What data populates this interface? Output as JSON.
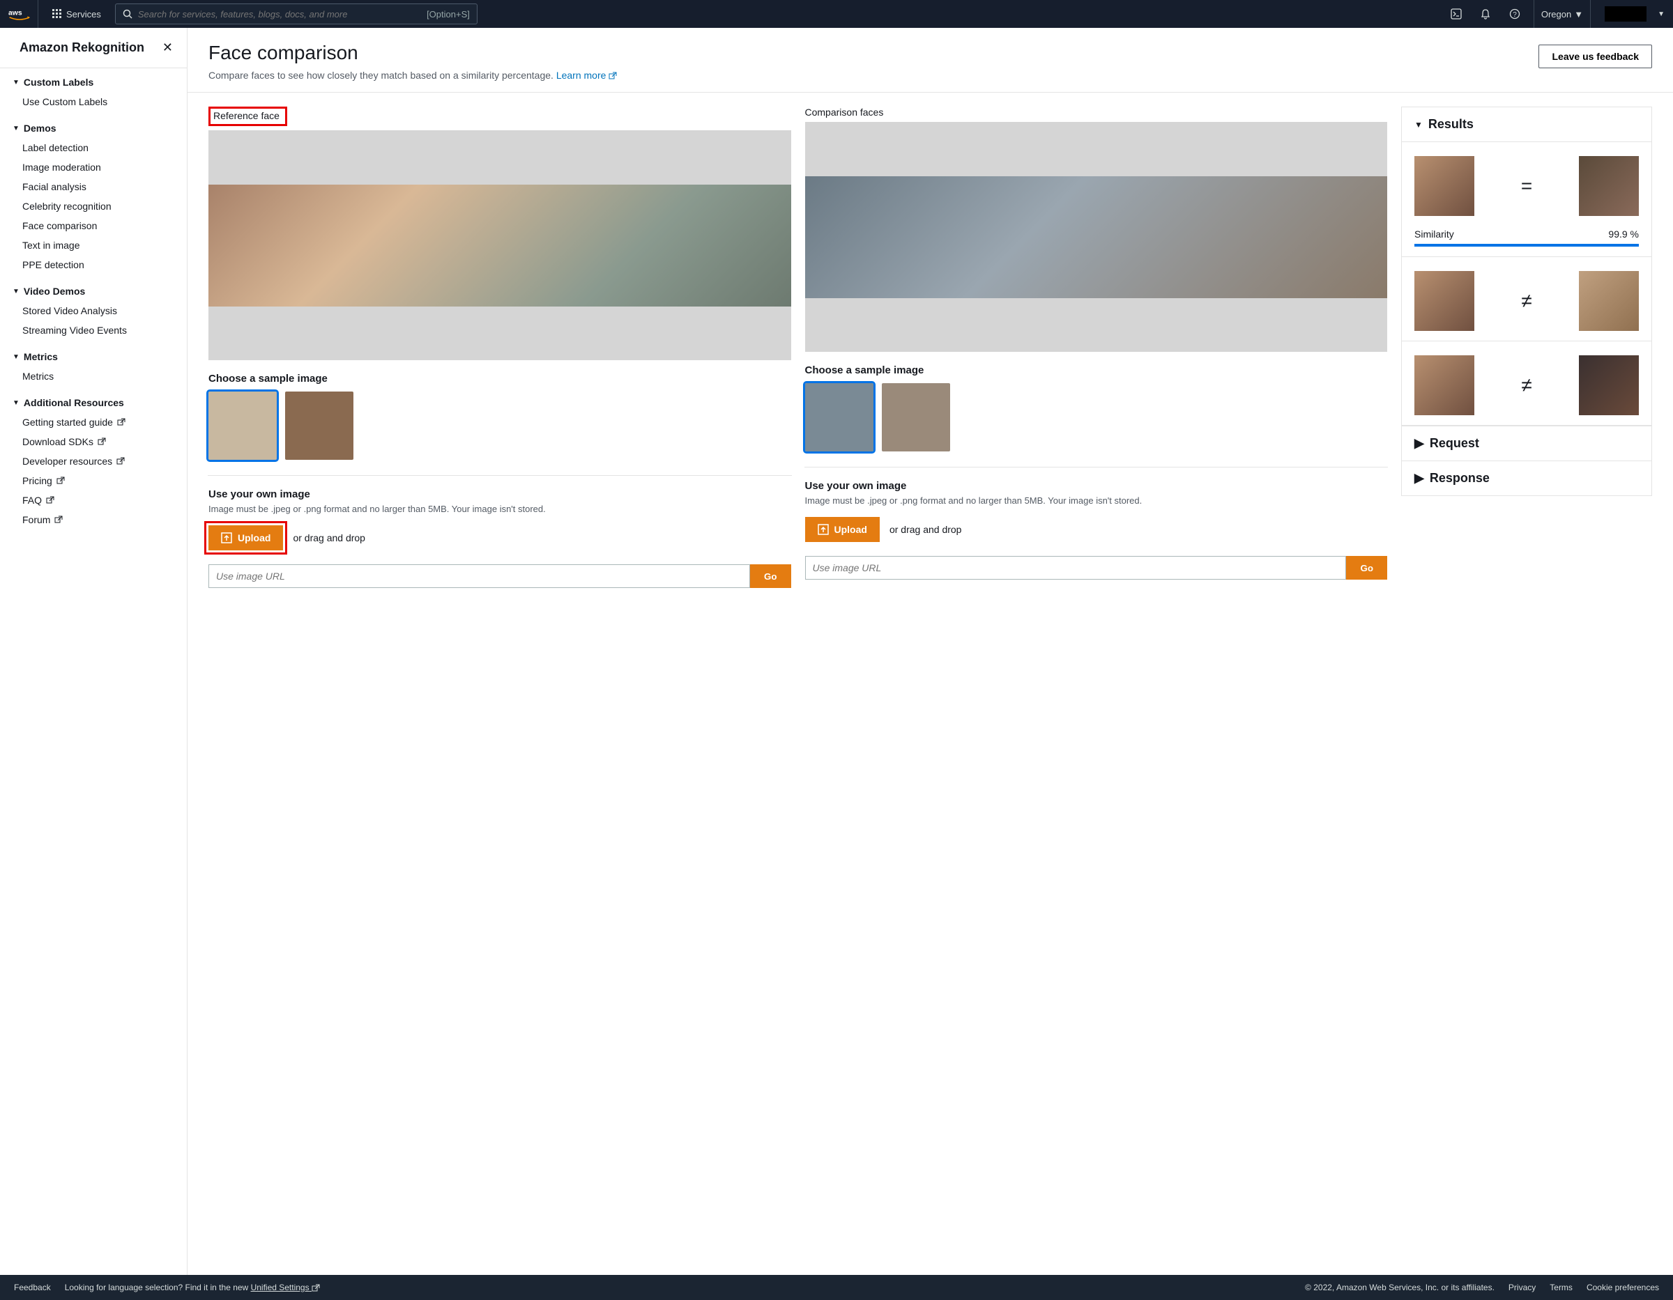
{
  "topnav": {
    "services": "Services",
    "search_placeholder": "Search for services, features, blogs, docs, and more",
    "search_shortcut": "[Option+S]",
    "region": "Oregon"
  },
  "sidebar": {
    "title": "Amazon Rekognition",
    "sections": [
      {
        "title": "Custom Labels",
        "items": [
          "Use Custom Labels"
        ]
      },
      {
        "title": "Demos",
        "items": [
          "Label detection",
          "Image moderation",
          "Facial analysis",
          "Celebrity recognition",
          "Face comparison",
          "Text in image",
          "PPE detection"
        ]
      },
      {
        "title": "Video Demos",
        "items": [
          "Stored Video Analysis",
          "Streaming Video Events"
        ]
      },
      {
        "title": "Metrics",
        "items": [
          "Metrics"
        ]
      },
      {
        "title": "Additional Resources",
        "items": [
          "Getting started guide",
          "Download SDKs",
          "Developer resources",
          "Pricing",
          "FAQ",
          "Forum"
        ]
      }
    ]
  },
  "page": {
    "title": "Face comparison",
    "subtitle": "Compare faces to see how closely they match based on a similarity percentage.",
    "learn_more": "Learn more",
    "feedback_btn": "Leave us feedback"
  },
  "ref": {
    "label": "Reference face",
    "choose": "Choose a sample image",
    "own_title": "Use your own image",
    "own_sub": "Image must be .jpeg or .png format and no larger than 5MB. Your image isn't stored.",
    "upload": "Upload",
    "drag": "or drag and drop",
    "url_placeholder": "Use image URL",
    "go": "Go"
  },
  "comp": {
    "label": "Comparison faces",
    "choose": "Choose a sample image",
    "own_title": "Use your own image",
    "own_sub": "Image must be .jpeg or .png format and no larger than 5MB. Your image isn't stored.",
    "upload": "Upload",
    "drag": "or drag and drop",
    "url_placeholder": "Use image URL",
    "go": "Go"
  },
  "results": {
    "title": "Results",
    "rows": [
      {
        "match": true,
        "sim_label": "Similarity",
        "sim_value": "99.9 %"
      },
      {
        "match": false
      },
      {
        "match": false
      }
    ],
    "request": "Request",
    "response": "Response"
  },
  "footer": {
    "feedback": "Feedback",
    "lang_text": "Looking for language selection? Find it in the new",
    "unified": "Unified Settings",
    "copyright": "© 2022, Amazon Web Services, Inc. or its affiliates.",
    "privacy": "Privacy",
    "terms": "Terms",
    "cookie": "Cookie preferences"
  }
}
